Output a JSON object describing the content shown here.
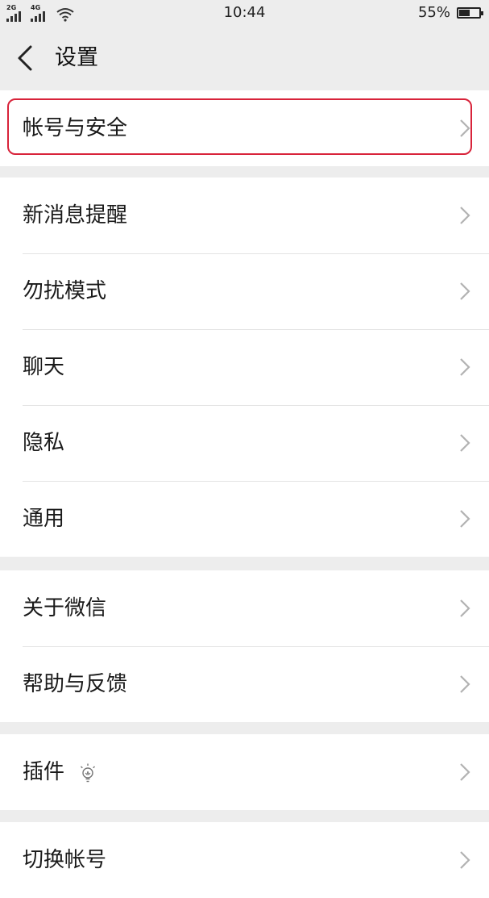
{
  "status_bar": {
    "network1": "2G",
    "network2": "4G",
    "time": "10:44",
    "battery_percent": "55%",
    "battery_level": 0.55
  },
  "header": {
    "title": "设置",
    "back_icon": "chevron-left-icon"
  },
  "groups": [
    {
      "items": [
        {
          "label": "帐号与安全",
          "highlighted": true
        }
      ]
    },
    {
      "items": [
        {
          "label": "新消息提醒"
        },
        {
          "label": "勿扰模式"
        },
        {
          "label": "聊天"
        },
        {
          "label": "隐私"
        },
        {
          "label": "通用"
        }
      ]
    },
    {
      "items": [
        {
          "label": "关于微信"
        },
        {
          "label": "帮助与反馈"
        }
      ]
    },
    {
      "items": [
        {
          "label": "插件",
          "icon": "lightbulb-icon"
        }
      ]
    },
    {
      "items": [
        {
          "label": "切换帐号"
        }
      ]
    }
  ],
  "colors": {
    "background": "#ededed",
    "row_background": "#ffffff",
    "highlight_border": "#d8233a",
    "chevron": "#b2b2b2"
  }
}
